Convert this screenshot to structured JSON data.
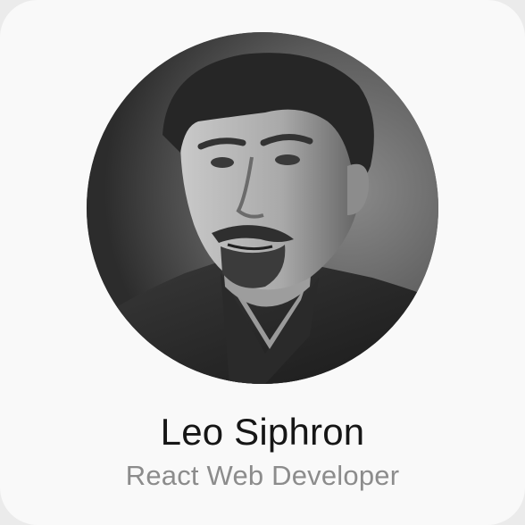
{
  "profile": {
    "name": "Leo Siphron",
    "role": "React Web Developer",
    "avatar": {
      "alt": "",
      "icon": "portrait-photo"
    }
  },
  "colors": {
    "card_background": "#f9f9f9",
    "name_text": "#161616",
    "role_text": "#8c8c8c"
  }
}
